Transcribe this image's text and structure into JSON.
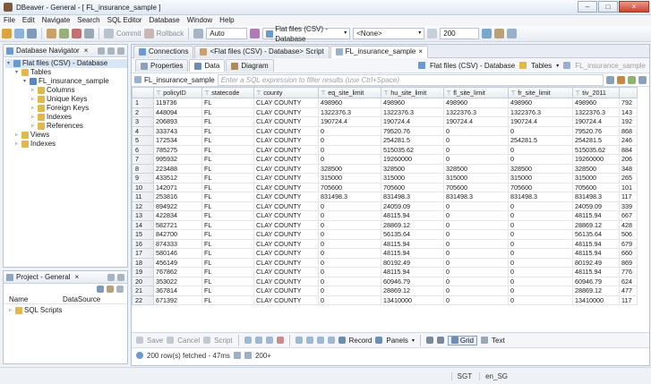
{
  "window": {
    "title": "DBeaver - General - [ FL_insurance_sample ]",
    "min": "–",
    "max": "□",
    "close": "×"
  },
  "menu": [
    "File",
    "Edit",
    "Navigate",
    "Search",
    "SQL Editor",
    "Database",
    "Window",
    "Help"
  ],
  "toolbar": {
    "commit": "Commit",
    "rollback": "Rollback",
    "txn_mode": "Auto",
    "datasource": "Flat files (CSV) - Database",
    "schema": "<None>",
    "fetch_size": "200"
  },
  "navigator": {
    "title": "Database Navigator",
    "close": "×",
    "tree": [
      {
        "label": "Flat files (CSV) - Database",
        "level": 0,
        "arrow": "▾",
        "icon": "#6a9ad0"
      },
      {
        "label": "Tables",
        "level": 1,
        "arrow": "▾",
        "icon": "#e2b84d"
      },
      {
        "label": "FL_insurance_sample",
        "level": 2,
        "arrow": "▾",
        "icon": "#5a86c5"
      },
      {
        "label": "Columns",
        "level": 3,
        "arrow": "▹",
        "icon": "#e2b84d"
      },
      {
        "label": "Unique Keys",
        "level": 3,
        "arrow": "▹",
        "icon": "#e2b84d"
      },
      {
        "label": "Foreign Keys",
        "level": 3,
        "arrow": "▹",
        "icon": "#e2b84d"
      },
      {
        "label": "Indexes",
        "level": 3,
        "arrow": "▹",
        "icon": "#e2b84d"
      },
      {
        "label": "References",
        "level": 3,
        "arrow": "▹",
        "icon": "#e2b84d"
      },
      {
        "label": "Views",
        "level": 1,
        "arrow": "▹",
        "icon": "#e2b84d"
      },
      {
        "label": "Indexes",
        "level": 1,
        "arrow": "▹",
        "icon": "#e2b84d"
      }
    ]
  },
  "project": {
    "title": "Project - General",
    "close": "×",
    "col_name": "Name",
    "col_ds": "DataSource",
    "items": [
      "SQL Scripts"
    ]
  },
  "editor_tabs": [
    {
      "label": "Connections",
      "active": false
    },
    {
      "label": "<Flat files (CSV) - Database> Script",
      "active": false
    },
    {
      "label": "FL_insurance_sample",
      "active": true,
      "close": "×"
    }
  ],
  "subtabs": [
    {
      "label": "Properties"
    },
    {
      "label": "Data",
      "active": true
    },
    {
      "label": "Diagram"
    }
  ],
  "subtabs_right": {
    "ds": "Flat files (CSV) - Database",
    "tables": "Tables",
    "obj": "FL_insurance_sample"
  },
  "filter": {
    "table": "FL_insurance_sample",
    "placeholder": "Enter a SQL expression to filter results (use Ctrl+Space)"
  },
  "grid": {
    "columns": [
      "policyID",
      "statecode",
      "county",
      "eq_site_limit",
      "hu_site_limit",
      "fl_site_limit",
      "fr_site_limit",
      "tiv_2011",
      ""
    ],
    "rows": [
      [
        "1",
        "119736",
        "FL",
        "CLAY COUNTY",
        "498960",
        "498960",
        "498960",
        "498960",
        "498960",
        "792"
      ],
      [
        "2",
        "448094",
        "FL",
        "CLAY COUNTY",
        "1322376.3",
        "1322376.3",
        "1322376.3",
        "1322376.3",
        "1322376.3",
        "143"
      ],
      [
        "3",
        "206893",
        "FL",
        "CLAY COUNTY",
        "190724.4",
        "190724.4",
        "190724.4",
        "190724.4",
        "190724.4",
        "192"
      ],
      [
        "4",
        "333743",
        "FL",
        "CLAY COUNTY",
        "0",
        "79520.76",
        "0",
        "0",
        "79520.76",
        "868"
      ],
      [
        "5",
        "172534",
        "FL",
        "CLAY COUNTY",
        "0",
        "254281.5",
        "0",
        "254281.5",
        "254281.5",
        "246"
      ],
      [
        "6",
        "785275",
        "FL",
        "CLAY COUNTY",
        "0",
        "515035.62",
        "0",
        "0",
        "515035.62",
        "884"
      ],
      [
        "7",
        "995932",
        "FL",
        "CLAY COUNTY",
        "0",
        "19260000",
        "0",
        "0",
        "19260000",
        "206"
      ],
      [
        "8",
        "223488",
        "FL",
        "CLAY COUNTY",
        "328500",
        "328500",
        "328500",
        "328500",
        "328500",
        "348"
      ],
      [
        "9",
        "433512",
        "FL",
        "CLAY COUNTY",
        "315000",
        "315000",
        "315000",
        "315000",
        "315000",
        "265"
      ],
      [
        "10",
        "142071",
        "FL",
        "CLAY COUNTY",
        "705600",
        "705600",
        "705600",
        "705600",
        "705600",
        "101"
      ],
      [
        "11",
        "253816",
        "FL",
        "CLAY COUNTY",
        "831498.3",
        "831498.3",
        "831498.3",
        "831498.3",
        "831498.3",
        "117"
      ],
      [
        "12",
        "894922",
        "FL",
        "CLAY COUNTY",
        "0",
        "24059.09",
        "0",
        "0",
        "24059.09",
        "339"
      ],
      [
        "13",
        "422834",
        "FL",
        "CLAY COUNTY",
        "0",
        "48115.94",
        "0",
        "0",
        "48115.94",
        "667"
      ],
      [
        "14",
        "582721",
        "FL",
        "CLAY COUNTY",
        "0",
        "28869.12",
        "0",
        "0",
        "28869.12",
        "428"
      ],
      [
        "15",
        "842700",
        "FL",
        "CLAY COUNTY",
        "0",
        "56135.64",
        "0",
        "0",
        "56135.64",
        "506"
      ],
      [
        "16",
        "874333",
        "FL",
        "CLAY COUNTY",
        "0",
        "48115.94",
        "0",
        "0",
        "48115.94",
        "679"
      ],
      [
        "17",
        "580146",
        "FL",
        "CLAY COUNTY",
        "0",
        "48115.94",
        "0",
        "0",
        "48115.94",
        "660"
      ],
      [
        "18",
        "456149",
        "FL",
        "CLAY COUNTY",
        "0",
        "80192.49",
        "0",
        "0",
        "80192.49",
        "869"
      ],
      [
        "19",
        "767862",
        "FL",
        "CLAY COUNTY",
        "0",
        "48115.94",
        "0",
        "0",
        "48115.94",
        "776"
      ],
      [
        "20",
        "353022",
        "FL",
        "CLAY COUNTY",
        "0",
        "60946.79",
        "0",
        "0",
        "60946.79",
        "624"
      ],
      [
        "21",
        "367814",
        "FL",
        "CLAY COUNTY",
        "0",
        "28869.12",
        "0",
        "0",
        "28869.12",
        "477"
      ],
      [
        "22",
        "671392",
        "FL",
        "CLAY COUNTY",
        "0",
        "13410000",
        "0",
        "0",
        "13410000",
        "117"
      ]
    ]
  },
  "bottom_toolbar": {
    "save": "Save",
    "cancel": "Cancel",
    "script": "Script",
    "record": "Record",
    "panels": "Panels",
    "grid": "Grid",
    "text": "Text"
  },
  "status": {
    "fetched": "200 row(s) fetched - 47ms",
    "count": "200+"
  },
  "statusbar": {
    "tz": "SGT",
    "locale": "en_SG"
  }
}
